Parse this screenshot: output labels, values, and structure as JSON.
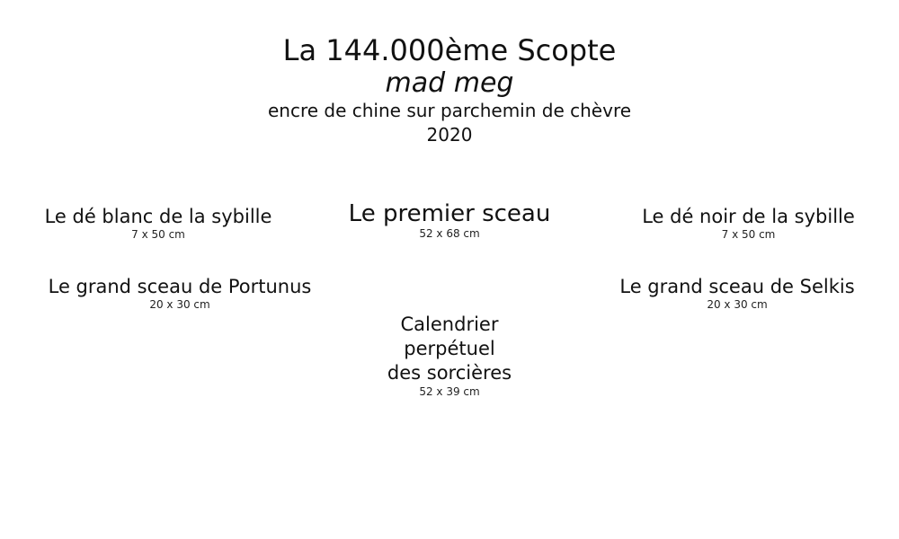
{
  "header": {
    "title": "La 144.000ème Scopte",
    "artist": "mad meg",
    "medium": "encre de chine sur parchemin de chèvre",
    "year": "2020"
  },
  "pieces": {
    "white_die": {
      "name": "Le dé blanc de la sybille",
      "size": "7 x 50 cm"
    },
    "first_seal": {
      "name": "Le premier sceau",
      "size": "52 x 68 cm"
    },
    "black_die": {
      "name": "Le dé noir de la sybille",
      "size": "7 x 50 cm"
    },
    "portunus": {
      "name": "Le grand sceau de Portunus",
      "size": "20 x 30 cm"
    },
    "selkis": {
      "name": "Le grand sceau de Selkis",
      "size": "20 x 30 cm"
    },
    "calendar": {
      "name_lines": [
        "Calendrier",
        "perpétuel",
        "des sorcières"
      ],
      "size": "52 x 39 cm"
    }
  }
}
